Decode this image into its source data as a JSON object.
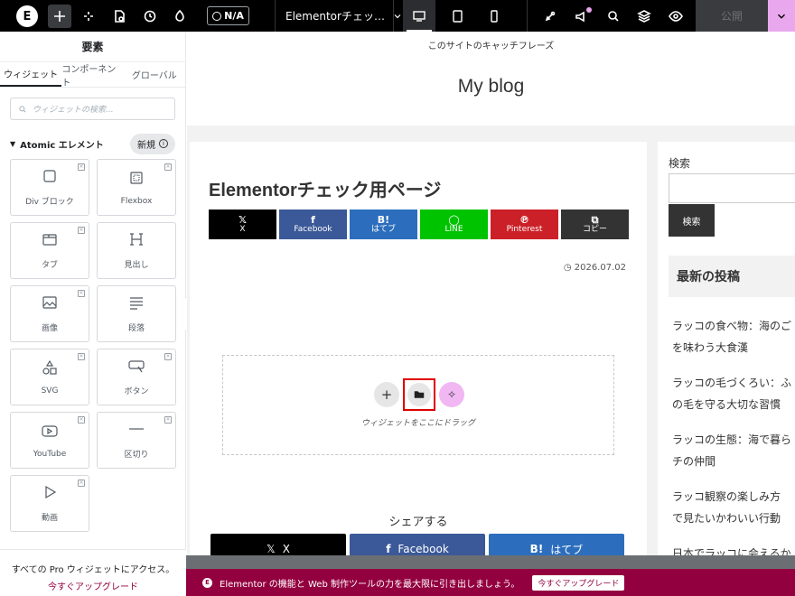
{
  "topbar": {
    "logo_letter": "E",
    "na_label": "N/A",
    "page_name": "Elementorチェッ…",
    "publish_label": "公開",
    "accent": "#e9a8ee"
  },
  "sidebar": {
    "title": "要素",
    "tabs": [
      "ウィジェット",
      "コンポーネント",
      "グローバル"
    ],
    "search_placeholder": "ウィジェットの検索...",
    "category": "Atomic エレメント",
    "badge": "新規",
    "widgets": [
      {
        "label": "Div ブロック",
        "icon": "square-icon"
      },
      {
        "label": "Flexbox",
        "icon": "flexbox-icon"
      },
      {
        "label": "タブ",
        "icon": "tabs-icon"
      },
      {
        "label": "見出し",
        "icon": "heading-icon"
      },
      {
        "label": "画像",
        "icon": "image-icon"
      },
      {
        "label": "段落",
        "icon": "paragraph-icon"
      },
      {
        "label": "SVG",
        "icon": "shapes-icon"
      },
      {
        "label": "ボタン",
        "icon": "button-icon"
      },
      {
        "label": "YouTube",
        "icon": "youtube-icon"
      },
      {
        "label": "区切り",
        "icon": "divider-icon"
      },
      {
        "label": "動画",
        "icon": "play-icon"
      }
    ],
    "footer_text": "すべての Pro ウィジェットにアクセス。",
    "footer_link": "今すぐアップグレード"
  },
  "preview": {
    "tagline": "このサイトのキャッチフレーズ",
    "site_title": "My blog",
    "post_title": "Elementorチェック用ページ",
    "share_buttons": [
      {
        "icon": "𝕏",
        "label": "X",
        "color": "#000000"
      },
      {
        "icon": "f",
        "label": "Facebook",
        "color": "#3b5998"
      },
      {
        "icon": "B!",
        "label": "はてブ",
        "color": "#2c6ebd"
      },
      {
        "icon": "LINE-icon",
        "label": "LINE",
        "color": "#00c300"
      },
      {
        "icon": "pinterest-icon",
        "label": "Pinterest",
        "color": "#cb2027"
      },
      {
        "icon": "copy-icon",
        "label": "コピー",
        "color": "#333333"
      }
    ],
    "date": "2026.07.02",
    "dropzone_text": "ウィジェットをここにドラッグ",
    "share_heading": "シェアする",
    "share_bottom": [
      {
        "icon": "𝕏",
        "label": "X",
        "color": "#000000"
      },
      {
        "icon": "f",
        "label": "Facebook",
        "color": "#3b5998"
      },
      {
        "icon": "B!",
        "label": "はてブ",
        "color": "#2c6ebd"
      }
    ],
    "sidebar_search_label": "検索",
    "sidebar_search_button": "検索",
    "recent_heading": "最新の投稿",
    "recent_posts": [
      "ラッコの食べ物：海のご",
      "を味わう大食漢",
      "ラッコの毛づくろい：ふ",
      "の毛を守る大切な習慣",
      "ラッコの生態：海で暮ら",
      "チの仲間",
      "ラッコ観察の楽しみ方",
      "で見たいかわいい行動",
      "日本でラッコに会えるか"
    ]
  },
  "banner": {
    "text": "Elementor の機能と Web 制作ツールの力を最大限に引き出しましょう。",
    "button": "今すぐアップグレード"
  }
}
